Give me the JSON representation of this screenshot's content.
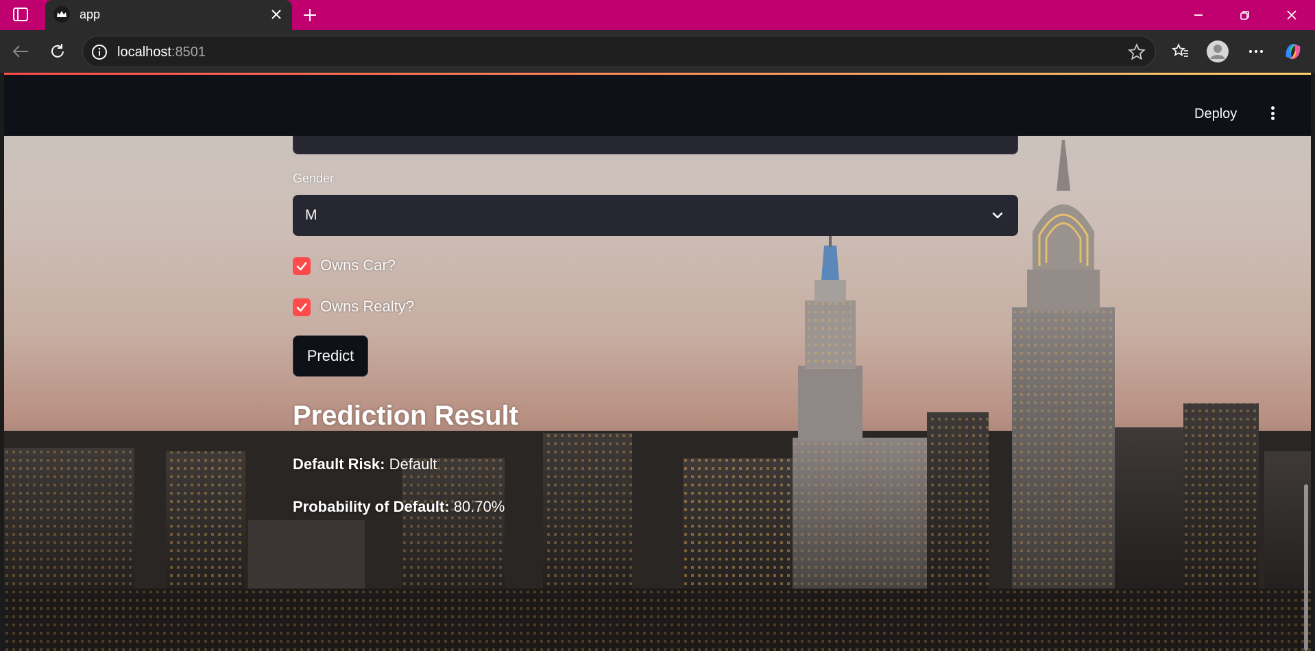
{
  "browser": {
    "tab_title": "app",
    "url_host": "localhost",
    "url_port": ":8501"
  },
  "header": {
    "deploy_label": "Deploy"
  },
  "form": {
    "gender_label": "Gender",
    "gender_value": "M",
    "owns_car_label": "Owns Car?",
    "owns_car_checked": true,
    "owns_realty_label": "Owns Realty?",
    "owns_realty_checked": true,
    "predict_label": "Predict"
  },
  "result": {
    "title": "Prediction Result",
    "risk_label": "Default Risk:",
    "risk_value": "Default",
    "prob_label": "Probability of Default:",
    "prob_value": "80.70%"
  },
  "colors": {
    "tabstrip": "#c0006e",
    "accent": "#ff4b4b",
    "header_bg": "#0e1117",
    "widget_bg": "#262730"
  }
}
